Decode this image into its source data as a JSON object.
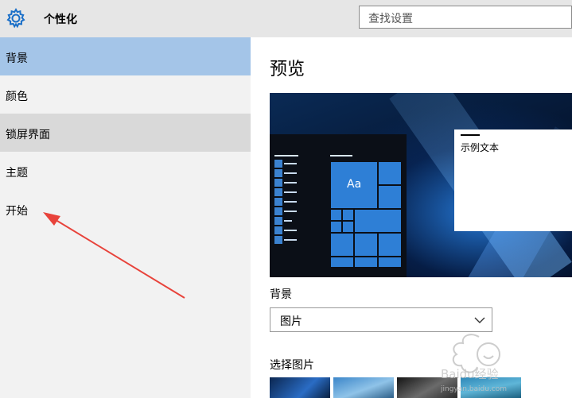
{
  "header": {
    "title": "个性化",
    "search_placeholder": "查找设置",
    "settings_icon": "gear-icon"
  },
  "sidebar": {
    "items": [
      {
        "label": "背景",
        "state": "selected"
      },
      {
        "label": "颜色",
        "state": "normal"
      },
      {
        "label": "锁屏界面",
        "state": "hover"
      },
      {
        "label": "主题",
        "state": "normal"
      },
      {
        "label": "开始",
        "state": "normal"
      }
    ]
  },
  "main": {
    "preview_title": "预览",
    "preview": {
      "tile_label": "Aa",
      "sample_text": "示例文本"
    },
    "background_label": "背景",
    "background_select": {
      "value": "图片",
      "icon": "chevron-down-icon"
    },
    "choose_picture_label": "选择图片"
  },
  "annotation": {
    "color": "#e8433b",
    "points_to": "开始"
  },
  "watermark": {
    "text": "Baidu经验",
    "subtext": "jingyan.baidu.com"
  },
  "colors": {
    "titlebar_bg": "#e6e6e6",
    "sidebar_bg": "#f2f2f2",
    "selected_bg": "#a4c5e8",
    "hover_bg": "#d9d9d9",
    "tile_blue": "#2e7fd6"
  }
}
